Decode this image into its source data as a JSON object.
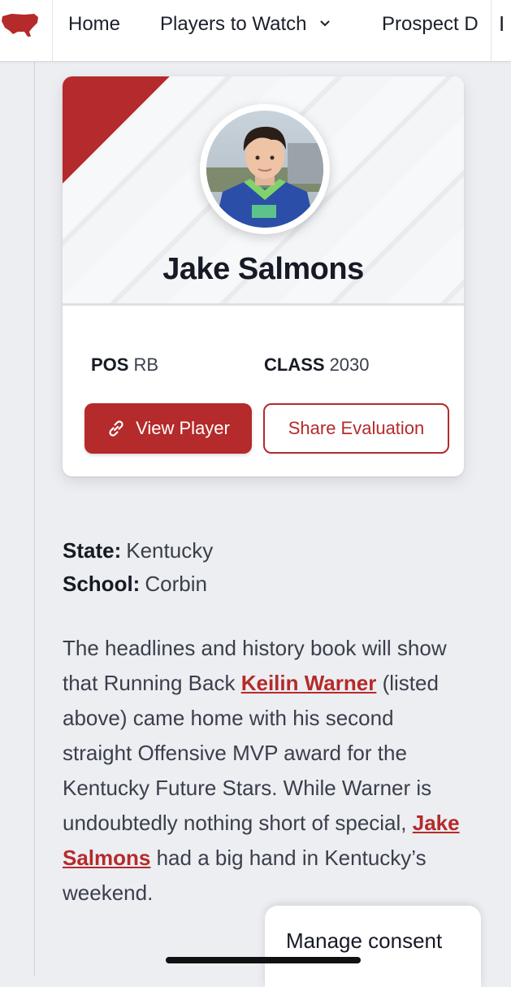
{
  "nav": {
    "logo_icon": "usa-map-icon",
    "items": [
      {
        "label": "Home"
      },
      {
        "label": "Players to Watch",
        "has_dropdown": true
      },
      {
        "label": "Prospect D"
      }
    ],
    "overflow_glyph": "I"
  },
  "player": {
    "name": "Jake Salmons",
    "position_label": "POS",
    "position_value": "RB",
    "class_label": "CLASS",
    "class_value": "2030",
    "view_button": "View Player",
    "view_button_icon": "link-icon",
    "share_button": "Share Evaluation"
  },
  "details": {
    "state_label": "State:",
    "state_value": "Kentucky",
    "school_label": "School:",
    "school_value": "Corbin"
  },
  "article": {
    "intro": "The headlines and history book will show that Running Back ",
    "link1": "Keilin Warner",
    "mid": " (listed above) came home with his second straight Offensive MVP award for the Kentucky Future Stars. While Warner is undoubtedly nothing short of special, ",
    "link2": "Jake Salmons",
    "outro": " had a big hand in Kentucky’s",
    "tail": "weekend."
  },
  "consent": {
    "label": "Manage consent"
  },
  "colors": {
    "brand_red": "#b52a2a",
    "text_dark": "#161a24",
    "text_body": "#3a3f4b"
  }
}
